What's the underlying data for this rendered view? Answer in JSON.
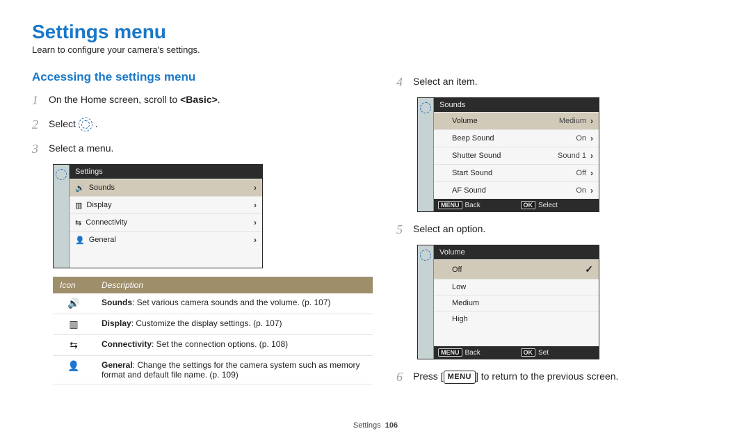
{
  "title": "Settings menu",
  "intro": "Learn to configure your camera's settings.",
  "section_heading": "Accessing the settings menu",
  "steps": {
    "1": {
      "text_before": "On the Home screen, scroll to ",
      "bold": "<Basic>",
      "text_after": "."
    },
    "2": {
      "text_before": "Select ",
      "text_after": "."
    },
    "3": {
      "text_before": "Select a menu."
    },
    "4": {
      "text_before": "Select an item."
    },
    "5": {
      "text_before": "Select an option."
    },
    "6": {
      "text_before": "Press [",
      "button": "MENU",
      "text_after": "] to return to the previous screen."
    }
  },
  "cam1": {
    "title": "Settings",
    "rows": [
      {
        "icon": "sounds-icon",
        "glyph": "🔊",
        "label": "Sounds",
        "selected": true
      },
      {
        "icon": "display-icon",
        "glyph": "▥",
        "label": "Display"
      },
      {
        "icon": "connectivity-icon",
        "glyph": "⇆",
        "label": "Connectivity"
      },
      {
        "icon": "general-icon",
        "glyph": "👤",
        "label": "General"
      }
    ]
  },
  "cam2": {
    "title": "Sounds",
    "rows": [
      {
        "label": "Volume",
        "value": "Medium",
        "selected": true
      },
      {
        "label": "Beep Sound",
        "value": "On"
      },
      {
        "label": "Shutter Sound",
        "value": "Sound 1"
      },
      {
        "label": "Start Sound",
        "value": "Off"
      },
      {
        "label": "AF Sound",
        "value": "On"
      }
    ],
    "footer": {
      "back_btn": "MENU",
      "back_label": "Back",
      "ok_btn": "OK",
      "ok_label": "Select"
    }
  },
  "cam3": {
    "title": "Volume",
    "rows": [
      {
        "label": "Off",
        "selected": true,
        "checked": true
      },
      {
        "label": "Low"
      },
      {
        "label": "Medium"
      },
      {
        "label": "High"
      }
    ],
    "footer": {
      "back_btn": "MENU",
      "back_label": "Back",
      "ok_btn": "OK",
      "ok_label": "Set"
    }
  },
  "desc_table": {
    "head": {
      "icon": "Icon",
      "desc": "Description"
    },
    "rows": [
      {
        "icon": "sounds-icon",
        "glyph": "🔊",
        "bold": "Sounds",
        "rest": ": Set various camera sounds and the volume. (p. 107)"
      },
      {
        "icon": "display-icon",
        "glyph": "▥",
        "bold": "Display",
        "rest": ": Customize the display settings. (p. 107)"
      },
      {
        "icon": "connectivity-icon",
        "glyph": "⇆",
        "bold": "Connectivity",
        "rest": ": Set the connection options. (p. 108)"
      },
      {
        "icon": "general-icon",
        "glyph": "👤",
        "bold": "General",
        "rest": ": Change the settings for the camera system such as memory format and default file name. (p. 109)"
      }
    ]
  },
  "footer": {
    "section": "Settings",
    "page": "106"
  }
}
